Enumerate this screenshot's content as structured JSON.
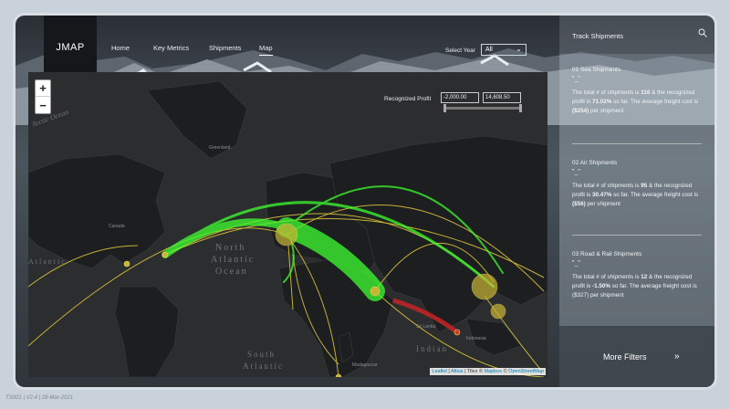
{
  "app": {
    "logo": "JMAP"
  },
  "nav": {
    "items": [
      {
        "label": "Home"
      },
      {
        "label": "Key Metrics"
      },
      {
        "label": "Shipments"
      },
      {
        "label": "Map"
      }
    ],
    "active": "Map"
  },
  "year_filter": {
    "label": "Select Year",
    "value": "All"
  },
  "map": {
    "zoom_in": "+",
    "zoom_out": "−",
    "recognized_profit_label": "Recognized Profit",
    "profit_min": "-2,000.00",
    "profit_max": "14,608.50",
    "ocean_labels": {
      "north_atlantic_1": "North",
      "north_atlantic_2": "Atlantic",
      "north_atlantic_3": "Ocean",
      "south_atlantic_1": "South",
      "south_atlantic_2": "Atlantic",
      "indian": "Indian",
      "arctic": "Arctic Ocean",
      "atlantic_left": "Atlantic"
    },
    "place_labels": {
      "greenland": "Greenland",
      "canada": "Canada",
      "sri_lanka": "Sri Lanka",
      "indonesia": "Indonesia",
      "madagascar": "Madagascar"
    },
    "attribution": {
      "leaflet": "Leaflet",
      "altius": "Altius",
      "tiles": "Tiles ©",
      "mapbox": "Mapbox",
      "copy": "©",
      "osm": "OpenStreetMap"
    }
  },
  "panel": {
    "title": "Track Shipments",
    "cards": [
      {
        "heading": "01   Sea Shipments",
        "dash": "\"_\"",
        "p1": "The total # of shipments is ",
        "n1": "116",
        "p2": " & the recognized profit  is ",
        "n2": "71.02%",
        "p3": " so far. The average freight cost is ",
        "n3": "($254)",
        "p4": " per shipment"
      },
      {
        "heading": "02   Air Shipments",
        "dash": "\"_\"",
        "p1": "The total # of shipments is ",
        "n1": "95",
        "p2": " & the recognized profit  is ",
        "n2": "30.47%",
        "p3": " so far. The average freight cost is ",
        "n3": "($56)",
        "p4": " per shipment"
      },
      {
        "heading": "03   Road & Rail Shipments",
        "dash": "\"_\"",
        "p1": "The total # of shipments is ",
        "n1": "12",
        "p2": " & the recognized profit  is ",
        "n2": "-1.50%",
        "p3": " so far. The average freight cost is ($327) per shipment",
        "n3": "",
        "p4": ""
      }
    ],
    "more_filters": "More Filters",
    "more_arrow": "»"
  },
  "footer": "TS001 | V2.4 | 28-Mar-2021",
  "colors": {
    "arc_green": "#3dff2f",
    "arc_yellow": "#d8c23a",
    "arc_red": "#c42424",
    "node": "#c9b534"
  }
}
